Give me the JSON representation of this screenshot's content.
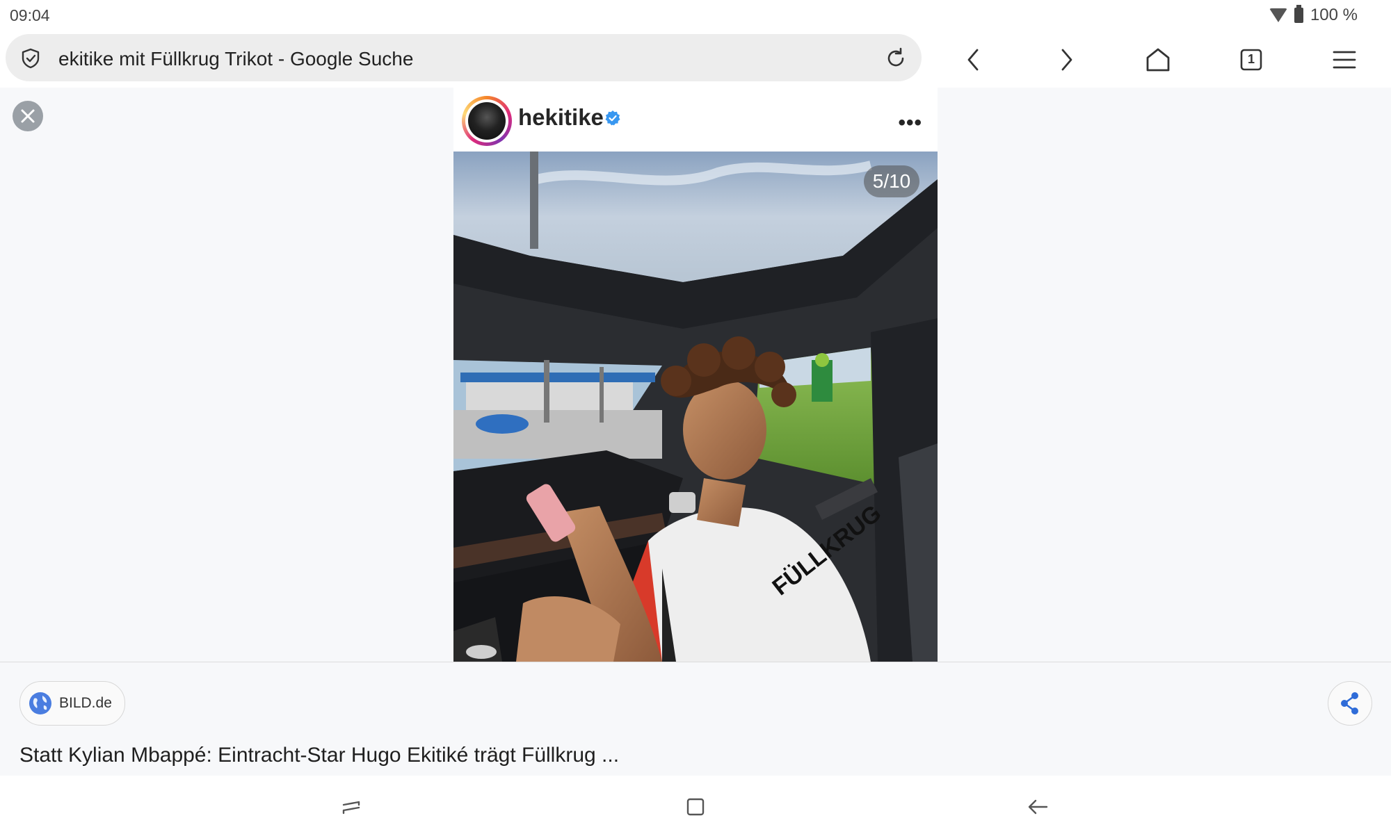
{
  "status_bar": {
    "time": "09:04",
    "battery": "100 %"
  },
  "browser": {
    "url_text": "ekitike mit Füllkrug Trikot - Google Suche",
    "tab_count": "1"
  },
  "instagram_post": {
    "username": "hekitike",
    "verified": true,
    "slide_counter": "5/10",
    "jersey_text": "FÜLLKRUG"
  },
  "result": {
    "source": "BILD.de",
    "headline": "Statt Kylian Mbappé: Eintracht-Star Hugo Ekitiké trägt Füllkrug ..."
  },
  "colors": {
    "accent": "#4a7de0",
    "verified": "#3897f0"
  }
}
